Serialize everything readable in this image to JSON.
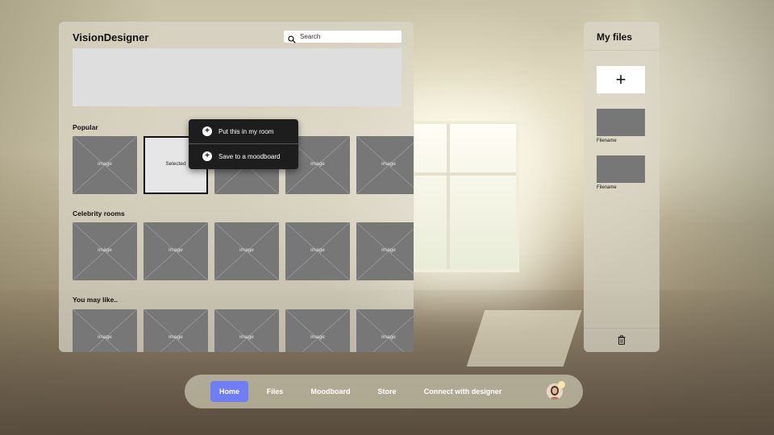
{
  "app": {
    "title": "VisionDesigner"
  },
  "search": {
    "placeholder": "Search",
    "value": "",
    "icon": "search-icon"
  },
  "sections": {
    "popular": {
      "title": "Popular",
      "items": [
        {
          "label": "image",
          "selected": false
        },
        {
          "label": "Selected",
          "selected": true
        },
        {
          "label": "image",
          "selected": false
        },
        {
          "label": "image",
          "selected": false
        },
        {
          "label": "image",
          "selected": false
        }
      ]
    },
    "celebrity": {
      "title": "Celebrity rooms",
      "items": [
        {
          "label": "image"
        },
        {
          "label": "image"
        },
        {
          "label": "image"
        },
        {
          "label": "image"
        },
        {
          "label": "image"
        }
      ]
    },
    "may_like": {
      "title": "You may like..",
      "items": [
        {
          "label": "image"
        },
        {
          "label": "image"
        },
        {
          "label": "image"
        },
        {
          "label": "image"
        },
        {
          "label": "image"
        }
      ]
    }
  },
  "context_menu": {
    "items": [
      {
        "label": "Put this in my room",
        "icon": "plus-circle-icon"
      },
      {
        "label": "Save to a moodboard",
        "icon": "plus-circle-icon"
      }
    ]
  },
  "files": {
    "title": "My files",
    "add_label": "+",
    "items": [
      {
        "name": "Filename"
      },
      {
        "name": "Filename"
      }
    ],
    "delete_icon": "trash-icon"
  },
  "nav": {
    "items": [
      {
        "label": "Home",
        "active": true
      },
      {
        "label": "Files",
        "active": false
      },
      {
        "label": "Moodboard",
        "active": false
      },
      {
        "label": "Store",
        "active": false
      },
      {
        "label": "Connect with designer",
        "active": false
      }
    ]
  },
  "colors": {
    "accent": "#6f7ef6",
    "thumb": "#777777",
    "menu": "#1d1d1d",
    "status_dot": "#f7e9a6"
  }
}
